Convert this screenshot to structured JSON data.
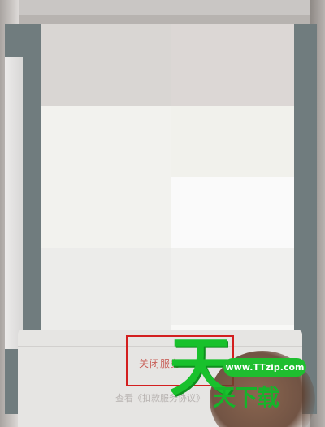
{
  "sheet": {
    "close_service_label": "关闭服务",
    "agreement_link_text": "查看《扣款服务协议》"
  },
  "watermark": {
    "brand_char": "天",
    "url": "www.TTzip.com",
    "brand_text": "天下载"
  },
  "colors": {
    "highlight_border": "#d31f1f",
    "close_service_text": "#c9625b",
    "watermark_green": "#18c12c"
  }
}
